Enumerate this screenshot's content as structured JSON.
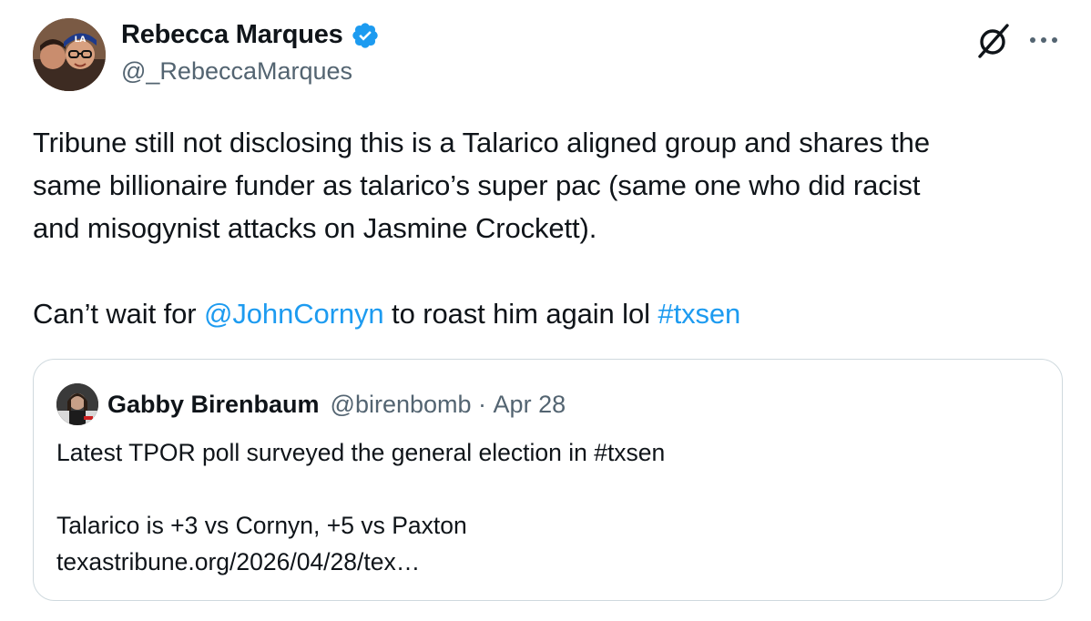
{
  "author": {
    "display_name": "Rebecca Marques",
    "handle": "@_RebeccaMarques"
  },
  "icons": {
    "verified": "verified-badge-icon",
    "grok": "grok-icon",
    "more": "more-icon"
  },
  "colors": {
    "link": "#1d9bf0",
    "secondary_text": "#536471",
    "border": "#cfd9de"
  },
  "post": {
    "line1": "Tribune still not disclosing this is a Talarico aligned group and shares the",
    "line2": "same billionaire funder as talarico’s super pac (same one who did racist",
    "line3": "and misogynist attacks on Jasmine Crockett).",
    "line4_prefix": "Can’t wait for ",
    "mention": "@JohnCornyn",
    "line4_middle": " to roast him again lol ",
    "hashtag": "#txsen"
  },
  "quoted": {
    "display_name": "Gabby Birenbaum",
    "handle": "@birenbomb",
    "separator": " · ",
    "date": "Apr 28",
    "line1": "Latest TPOR poll surveyed the general election in #txsen",
    "line2": "Talarico is +3 vs Cornyn, +5 vs Paxton",
    "line3": "texastribune.org/2026/04/28/tex…"
  }
}
